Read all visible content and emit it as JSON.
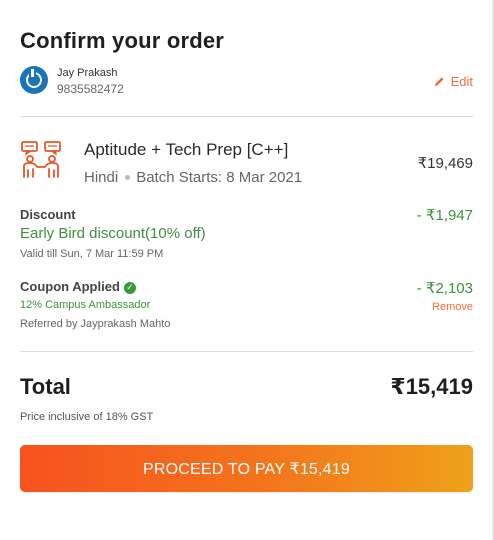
{
  "header": {
    "title": "Confirm your order"
  },
  "user": {
    "name": "Jay Prakash",
    "phone": "9835582472",
    "edit_label": "Edit"
  },
  "course": {
    "title": "Aptitude + Tech Prep [C++]",
    "language": "Hindi",
    "batch": "Batch Starts: 8 Mar 2021",
    "price": "₹19,469"
  },
  "discount": {
    "label": "Discount",
    "name": "Early Bird discount(10% off)",
    "validity": "Valid till Sun, 7 Mar 11:59 PM",
    "amount": "- ₹1,947"
  },
  "coupon": {
    "label": "Coupon Applied",
    "name": "12% Campus Ambassador",
    "referrer": "Referred by Jayprakash Mahto",
    "amount": "- ₹2,103",
    "remove_label": "Remove"
  },
  "total": {
    "label": "Total",
    "value": "₹15,419",
    "gst_note": "Price inclusive of 18% GST"
  },
  "cta": {
    "label": "PROCEED TO PAY ₹15,419"
  },
  "colors": {
    "accent": "#f26d3b",
    "success": "#3f8f3f",
    "avatar": "#1b72bd"
  }
}
